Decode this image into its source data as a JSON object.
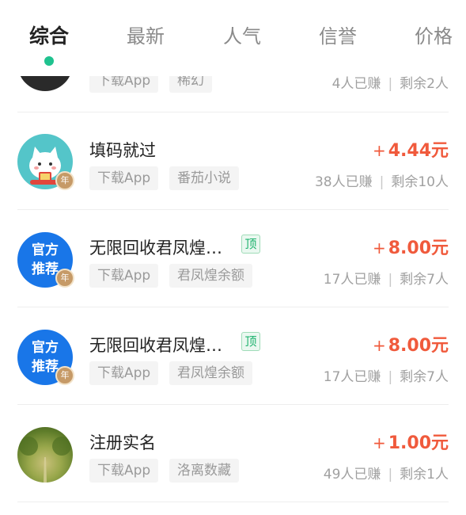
{
  "tabs": [
    {
      "label": "综合"
    },
    {
      "label": "最新"
    },
    {
      "label": "人气"
    },
    {
      "label": "信誉"
    },
    {
      "label": "价格"
    }
  ],
  "accent_color": "#1fc28f",
  "price_color": "#f05a3c",
  "tasks": [
    {
      "avatar": "dark-avatar",
      "title": "",
      "tags": [
        "下载App",
        "稀幻"
      ],
      "price_prefix": "",
      "price": "",
      "earned": "4人已赚",
      "remaining": "剩余2人"
    },
    {
      "avatar": "cat-avatar",
      "title": "填码就过",
      "tags": [
        "下载App",
        "番茄小说"
      ],
      "year_badge": "年",
      "price_prefix": "+",
      "price": "4.44元",
      "earned": "38人已赚",
      "remaining": "剩余10人"
    },
    {
      "avatar_text": [
        "官方",
        "推荐"
      ],
      "title": "无限回收君凤煌…",
      "top_badge": "顶",
      "tags": [
        "下载App",
        "君凤煌余额"
      ],
      "year_badge": "年",
      "price_prefix": "+",
      "price": "8.00元",
      "earned": "17人已赚",
      "remaining": "剩余7人"
    },
    {
      "avatar_text": [
        "官方",
        "推荐"
      ],
      "title": "无限回收君凤煌…",
      "top_badge": "顶",
      "tags": [
        "下载App",
        "君凤煌余额"
      ],
      "year_badge": "年",
      "price_prefix": "+",
      "price": "8.00元",
      "earned": "17人已赚",
      "remaining": "剩余7人"
    },
    {
      "avatar": "forest-avatar",
      "title": "注册实名",
      "tags": [
        "下载App",
        "洛离数藏"
      ],
      "price_prefix": "+",
      "price": "1.00元",
      "earned": "49人已赚",
      "remaining": "剩余1人"
    }
  ],
  "stats_separator": "|"
}
